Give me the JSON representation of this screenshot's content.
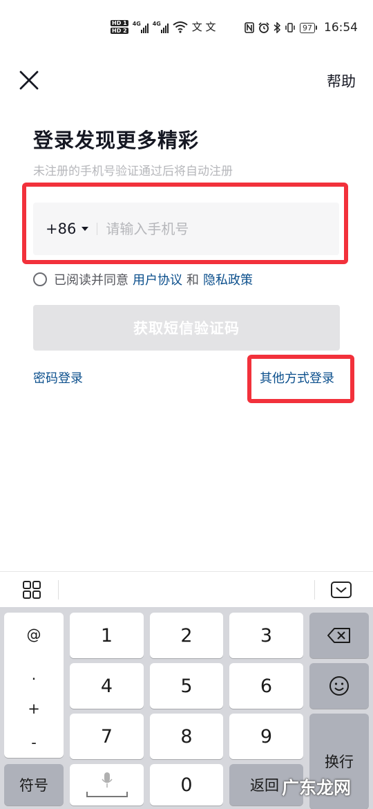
{
  "status_bar": {
    "hd1": "HD 1",
    "hd2": "HD 2",
    "net1": "4G",
    "net2": "4G",
    "extra_glyphs": "文 文",
    "battery": "97",
    "time": "16:54"
  },
  "header": {
    "help_label": "帮助"
  },
  "main": {
    "title": "登录发现更多精彩",
    "subtitle": "未注册的手机号验证通过后将自动注册",
    "country_code": "+86",
    "phone_placeholder": "请输入手机号",
    "agree_prefix": "已阅读并同意",
    "user_agreement": "用户协议",
    "and": "和",
    "privacy_policy": "隐私政策",
    "sms_button": "获取短信验证码",
    "password_login": "密码登录",
    "other_login": "其他方式登录"
  },
  "keyboard": {
    "symbols": [
      "@",
      ".",
      "+",
      "-"
    ],
    "keys": [
      "1",
      "2",
      "3",
      "4",
      "5",
      "6",
      "7",
      "8",
      "9",
      "0"
    ],
    "symbol_key": "符号",
    "return_key": "返回",
    "enter_key": "换行"
  },
  "watermark": "广东龙网",
  "colors": {
    "accent_link": "#0b4f8c",
    "highlight": "#f2313b",
    "button_disabled": "#e3e3e5"
  }
}
